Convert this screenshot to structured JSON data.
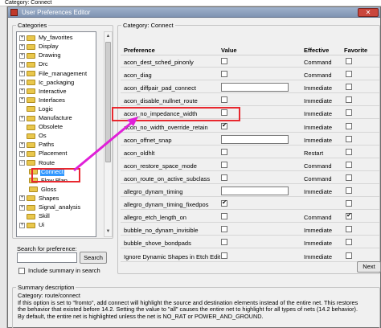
{
  "background_window": {
    "text": "Category: Connect"
  },
  "window": {
    "title": "User Preferences Editor",
    "close_label": "✕"
  },
  "categories": {
    "label": "Categories",
    "items": [
      {
        "label": "My_favorites",
        "expander": "+",
        "indent": 0
      },
      {
        "label": "Display",
        "expander": "+",
        "indent": 0
      },
      {
        "label": "Drawing",
        "expander": "+",
        "indent": 0
      },
      {
        "label": "Drc",
        "expander": "+",
        "indent": 0
      },
      {
        "label": "File_management",
        "expander": "+",
        "indent": 0
      },
      {
        "label": "Ic_packaging",
        "expander": "+",
        "indent": 0
      },
      {
        "label": "Interactive",
        "expander": "+",
        "indent": 0
      },
      {
        "label": "Interfaces",
        "expander": "+",
        "indent": 0
      },
      {
        "label": "Logic",
        "expander": "",
        "indent": 0
      },
      {
        "label": "Manufacture",
        "expander": "+",
        "indent": 0
      },
      {
        "label": "Obsolete",
        "expander": "",
        "indent": 0
      },
      {
        "label": "Os",
        "expander": "",
        "indent": 0
      },
      {
        "label": "Paths",
        "expander": "+",
        "indent": 0
      },
      {
        "label": "Placement",
        "expander": "+",
        "indent": 0
      },
      {
        "label": "Route",
        "expander": "−",
        "indent": 0
      },
      {
        "label": "Connect",
        "expander": "",
        "indent": 1,
        "selected": true
      },
      {
        "label": "Flow Plan",
        "expander": "",
        "indent": 1
      },
      {
        "label": "Gloss",
        "expander": "",
        "indent": 1
      },
      {
        "label": "Shapes",
        "expander": "+",
        "indent": 0
      },
      {
        "label": "Signal_analysis",
        "expander": "+",
        "indent": 0
      },
      {
        "label": "Skill",
        "expander": "",
        "indent": 0
      },
      {
        "label": "Ui",
        "expander": "+",
        "indent": 0
      }
    ]
  },
  "search": {
    "label": "Search for preference:",
    "value": "",
    "button": "Search",
    "include_summary_label": "Include summary in search",
    "include_summary_checked": false
  },
  "preferences": {
    "group_label": "Category:   Connect",
    "columns": {
      "preference": "Preference",
      "value": "Value",
      "effective": "Effective",
      "favorite": "Favorite"
    },
    "rows": [
      {
        "name": "acon_dest_sched_pinonly",
        "type": "checkbox",
        "checked": false,
        "effective": "Command"
      },
      {
        "name": "acon_diag",
        "type": "checkbox",
        "checked": false,
        "effective": "Command"
      },
      {
        "name": "acon_diffpair_pad_connect",
        "type": "text",
        "effective": "Immediate"
      },
      {
        "name": "acon_disable_nullnet_route",
        "type": "checkbox",
        "checked": false,
        "effective": "Immediate"
      },
      {
        "name": "acon_no_impedance_width",
        "type": "checkbox",
        "checked": false,
        "effective": "Immediate"
      },
      {
        "name": "acon_no_width_override_retain",
        "type": "checkbox",
        "checked": true,
        "effective": "Immediate"
      },
      {
        "name": "acon_offnet_snap",
        "type": "text",
        "effective": "Immediate"
      },
      {
        "name": "acon_oldhlt",
        "type": "checkbox",
        "checked": false,
        "effective": "Restart"
      },
      {
        "name": "acon_restore_space_mode",
        "type": "checkbox",
        "checked": false,
        "effective": "Command"
      },
      {
        "name": "acon_route_on_active_subclass",
        "type": "checkbox",
        "checked": false,
        "effective": "Command"
      },
      {
        "name": "allegro_dynam_timing",
        "type": "text",
        "effective": "Immediate"
      },
      {
        "name": "allegro_dynam_timing_fixedpos",
        "type": "checkbox",
        "checked": true,
        "effective": ""
      },
      {
        "name": "allegro_etch_length_on",
        "type": "checkbox",
        "checked": false,
        "effective": "Command",
        "favorite": true
      },
      {
        "name": "bubble_no_dynam_invisible",
        "type": "checkbox",
        "checked": false,
        "effective": "Immediate"
      },
      {
        "name": "bubble_shove_bondpads",
        "type": "checkbox",
        "checked": false,
        "effective": "Immediate"
      },
      {
        "name": "Ignore Dynamic Shapes in Etch Edit",
        "type": "checkbox",
        "checked": false,
        "effective": "Immediate"
      }
    ],
    "next_button": "Next"
  },
  "summary": {
    "label": "Summary description",
    "lines": [
      "Category: route/connect",
      "If this option is set to \"fromto\", add connect will highlight the source and destination elements instead of the entire net. This restores",
      "the behavior that existed before 14.2. Setting the value to \"all\" causes the entire net to highlight for all types of nets (14.2 behavior).",
      "By default, the entire net is highlighted unless the net is NO_RAT or POWER_AND_GROUND."
    ]
  },
  "annotations": {
    "highlight_color": "#e8282f",
    "arrow_color": "#e020d8"
  }
}
